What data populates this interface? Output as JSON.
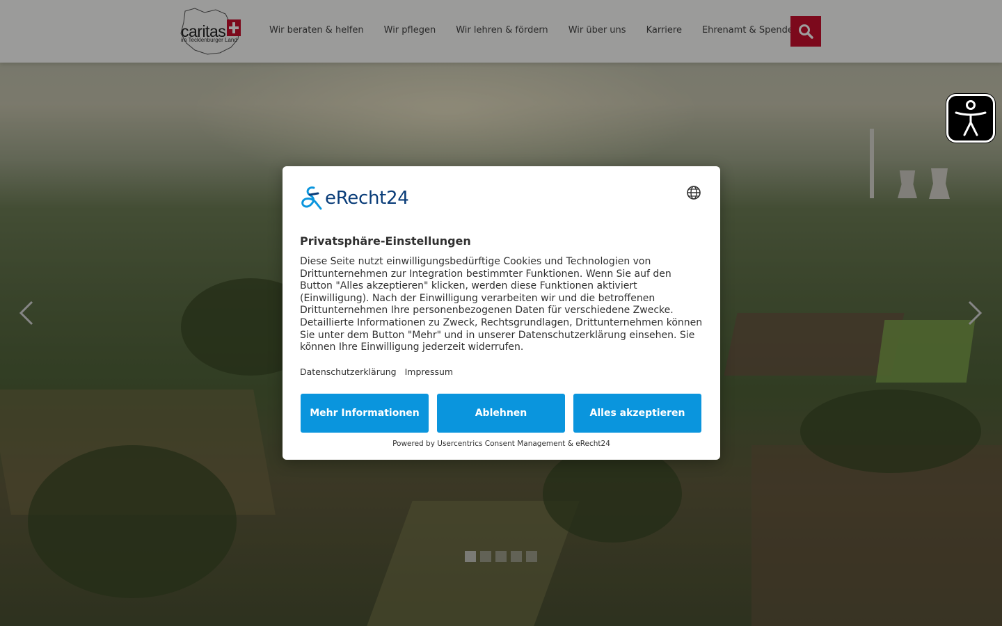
{
  "header": {
    "logo": {
      "brand": "caritas",
      "subtitle": "im Tecklenburger Land"
    },
    "nav": [
      {
        "label": "Wir beraten & helfen"
      },
      {
        "label": "Wir pflegen"
      },
      {
        "label": "Wir lehren & fördern"
      },
      {
        "label": "Wir über uns"
      },
      {
        "label": "Karriere"
      },
      {
        "label": "Ehrenamt & Spenden"
      }
    ],
    "search_icon": "search-icon"
  },
  "slider": {
    "prev_icon": "chevron-left-icon",
    "next_icon": "chevron-right-icon",
    "dot_count": 5,
    "active_dot": 1
  },
  "accessibility": {
    "icon": "accessibility-person-icon"
  },
  "consent": {
    "brand": "eRecht24",
    "language_icon": "globe-icon",
    "title": "Privatsphäre-Einstellungen",
    "description": "Diese Seite nutzt einwilligungsbedürftige Cookies und Technologien von Drittunternehmen zur Integration bestimmter Funktionen. Wenn Sie auf den Button \"Alles akzeptieren\" klicken, werden diese Funktionen aktiviert (Einwilligung). Nach der Einwilligung verarbeiten wir und die betroffenen Drittunternehmen Ihre personenbezogenen Daten für verschiedene Zwecke. Detaillierte Informationen zu Zweck, Rechtsgrundlagen, Drittunternehmen können Sie unter dem Button \"Mehr\" und in unserer Datenschutzerklärung einsehen. Sie können Ihre Einwilligung jederzeit widerrufen.",
    "links": {
      "privacy": "Datenschutzerklärung",
      "imprint": "Impressum"
    },
    "buttons": {
      "more": "Mehr Informationen",
      "deny": "Ablehnen",
      "accept": "Alles akzeptieren"
    },
    "powered_by": "Powered by Usercentrics Consent Management & eRecht24"
  },
  "colors": {
    "caritas_red": "#c8102e",
    "consent_button": "#0a95dd",
    "erecht_blue": "#0a3d79"
  }
}
